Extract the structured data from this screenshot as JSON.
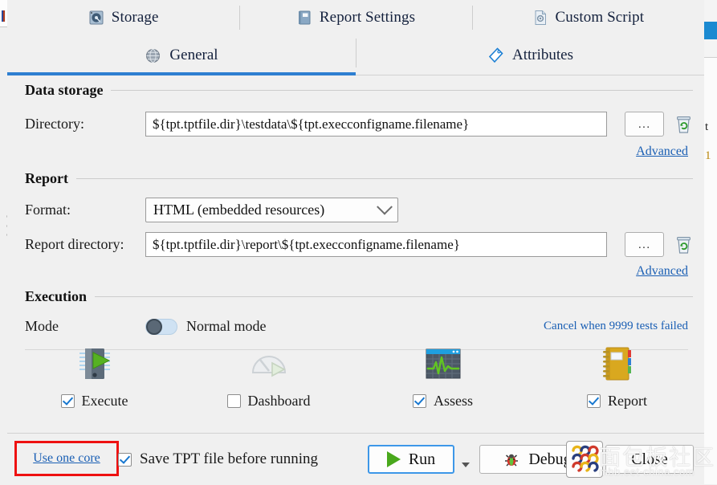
{
  "window": {
    "background_color": "#f0f0f0",
    "accent_color": "#2e7fd1"
  },
  "top_tabs": [
    {
      "label": "Storage",
      "icon": "hard-drive-icon",
      "active": false
    },
    {
      "label": "Report Settings",
      "icon": "notebook-icon",
      "active": false
    },
    {
      "label": "Custom Script",
      "icon": "script-gear-icon",
      "active": false
    }
  ],
  "sub_tabs": [
    {
      "label": "General",
      "icon": "globe-icon",
      "active": true
    },
    {
      "label": "Attributes",
      "icon": "tag-icon",
      "active": false
    }
  ],
  "data_storage": {
    "title": "Data storage",
    "directory_label": "Directory:",
    "directory_value": "${tpt.tptfile.dir}\\testdata\\${tpt.execconfigname.filename}",
    "browse_label": "...",
    "clean_icon": "recycle-bin-icon",
    "advanced_label": "Advanced"
  },
  "report": {
    "title": "Report",
    "format_label": "Format:",
    "format_value": "HTML (embedded resources)",
    "format_options": [
      "HTML (embedded resources)"
    ],
    "report_directory_label": "Report directory:",
    "report_directory_value": "${tpt.tptfile.dir}\\report\\${tpt.execconfigname.filename}",
    "browse_label": "...",
    "clean_icon": "recycle-bin-icon",
    "advanced_label": "Advanced"
  },
  "execution": {
    "title": "Execution",
    "mode_label": "Mode",
    "mode_value": "Normal mode",
    "mode_toggle_on": false,
    "cancel_link": "Cancel when 9999 tests failed",
    "failed_test_count": "9999",
    "actions": [
      {
        "label": "Execute",
        "icon": "execute-icon",
        "checked": true,
        "enabled": true
      },
      {
        "label": "Dashboard",
        "icon": "dashboard-icon",
        "checked": false,
        "enabled": false
      },
      {
        "label": "Assess",
        "icon": "assess-icon",
        "checked": true,
        "enabled": true
      },
      {
        "label": "Report",
        "icon": "report-icon",
        "checked": true,
        "enabled": true
      }
    ]
  },
  "footer": {
    "use_one_core_label": "Use one core",
    "use_one_core_highlight_color": "#ee1111",
    "save_tpt_label": "Save TPT file before running",
    "save_tpt_checked": true,
    "run_label": "Run",
    "debug_label": "Debug",
    "close_label": "Close"
  },
  "watermark": {
    "text_cn": "面包板社区",
    "url": "mbb.eet-china.com"
  }
}
